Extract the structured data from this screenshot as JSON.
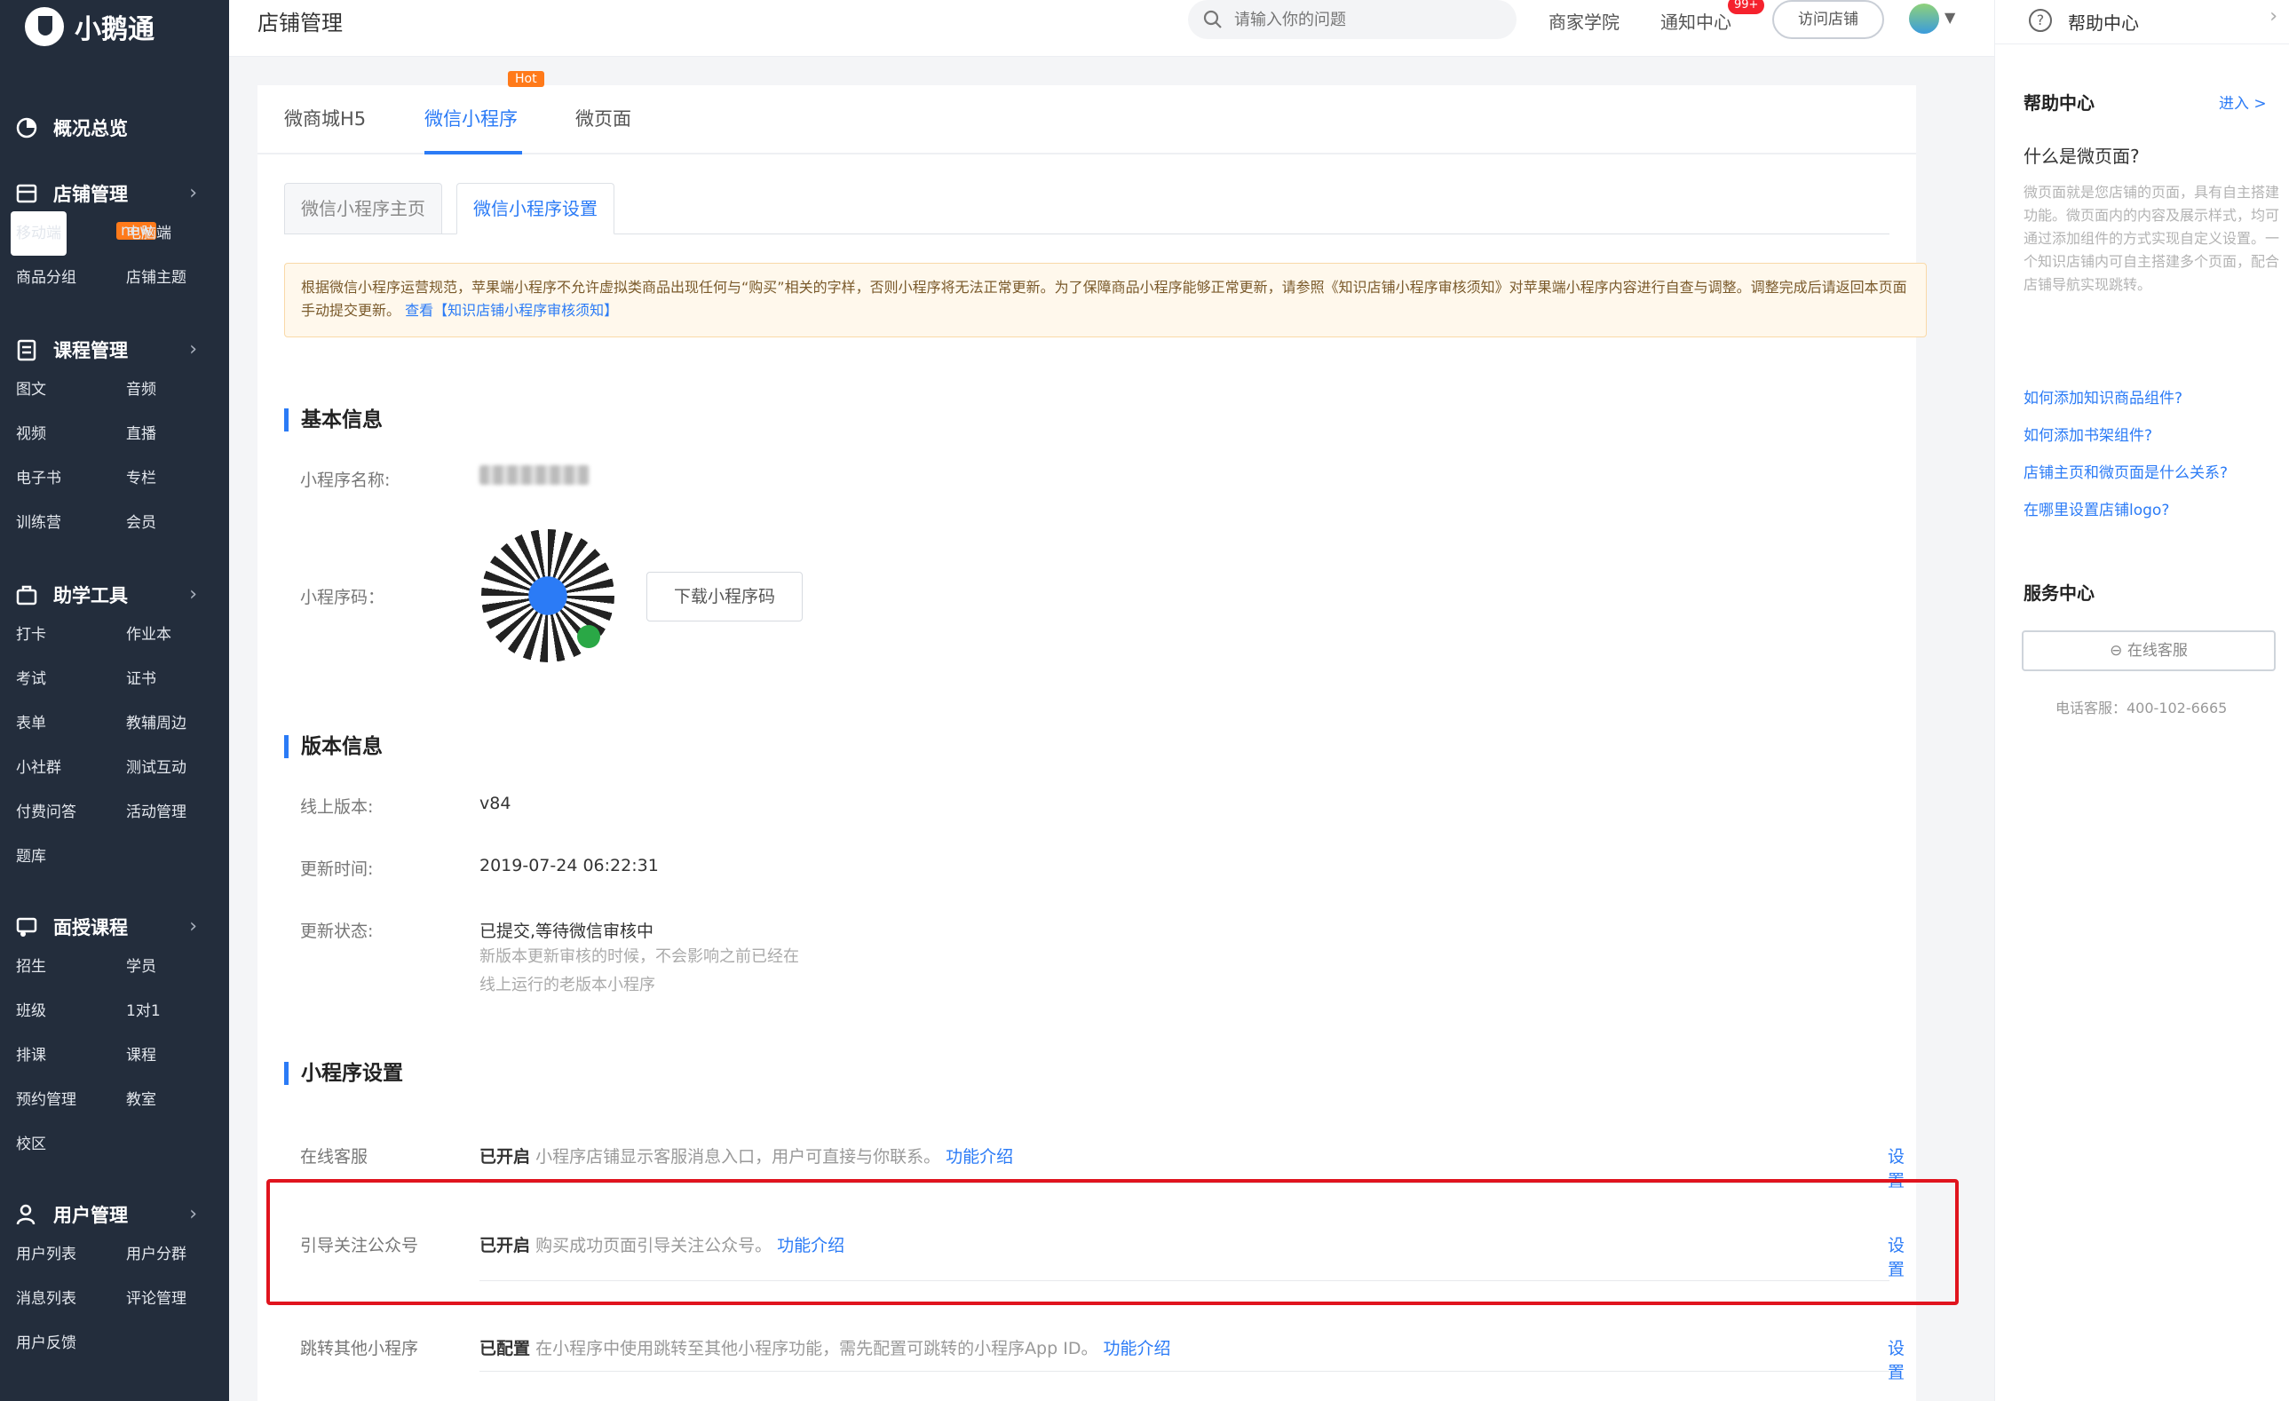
{
  "app": {
    "name": "小鹅通"
  },
  "sidebar": {
    "groups": [
      {
        "label": "概况总览",
        "items": []
      },
      {
        "label": "店铺管理",
        "items": [
          "移动端",
          "电脑端",
          "商品分组",
          "店铺主题"
        ],
        "new_tag": "new"
      },
      {
        "label": "课程管理",
        "items": [
          "图文",
          "音频",
          "视频",
          "直播",
          "电子书",
          "专栏",
          "训练营",
          "会员"
        ]
      },
      {
        "label": "助学工具",
        "items": [
          "打卡",
          "作业本",
          "考试",
          "证书",
          "表单",
          "教辅周边",
          "小社群",
          "测试互动",
          "付费问答",
          "活动管理",
          "题库"
        ]
      },
      {
        "label": "面授课程",
        "items": [
          "招生",
          "学员",
          "班级",
          "1对1",
          "排课",
          "课程",
          "预约管理",
          "教室",
          "校区"
        ]
      },
      {
        "label": "用户管理",
        "items": [
          "用户列表",
          "用户分群",
          "消息列表",
          "评论管理",
          "用户反馈"
        ]
      }
    ]
  },
  "topbar": {
    "title": "店铺管理",
    "search_placeholder": "请输入你的问题",
    "school": "商家学院",
    "notice": "通知中心",
    "notice_badge": "99+",
    "visit": "访问店铺"
  },
  "tabs": [
    "微商城H5",
    "微信小程序",
    "微页面"
  ],
  "hot_tag": "Hot",
  "subtabs": [
    "微信小程序主页",
    "微信小程序设置"
  ],
  "notice": {
    "text": "根据微信小程序运营规范，苹果端小程序不允许虚拟类商品出现任何与“购买”相关的字样，否则小程序将无法正常更新。为了保障商品小程序能够正常更新，请参照《知识店铺小程序审核须知》对苹果端小程序内容进行自查与调整。调整完成后请返回本页面手动提交更新。",
    "link": "查看【知识店铺小程序审核须知】"
  },
  "basic": {
    "title": "基本信息",
    "name_label": "小程序名称:",
    "code_label": "小程序码：",
    "download_btn": "下载小程序码"
  },
  "version": {
    "title": "版本信息",
    "online_label": "线上版本:",
    "online_value": "v84",
    "time_label": "更新时间:",
    "time_value": "2019-07-24 06:22:31",
    "status_label": "更新状态:",
    "status_value": "已提交,等待微信审核中",
    "status_note1": "新版本更新审核的时候，不会影响之前已经在",
    "status_note2": "线上运行的老版本小程序"
  },
  "settings": {
    "title": "小程序设置",
    "rows": [
      {
        "label": "在线客服",
        "state": "已开启",
        "desc": "小程序店铺显示客服消息入口，用户可直接与你联系。",
        "link": "功能介绍",
        "action": "设置"
      },
      {
        "label": "引导关注公众号",
        "state": "已开启",
        "desc": "购买成功页面引导关注公众号。",
        "link": "功能介绍",
        "action": "设置"
      },
      {
        "label": "跳转其他小程序",
        "state": "已配置",
        "desc": "在小程序中使用跳转至其他小程序功能，需先配置可跳转的小程序App ID。",
        "link": "功能介绍",
        "action": "设置"
      }
    ]
  },
  "help": {
    "top_title": "帮助中心",
    "section_title": "帮助中心",
    "enter": "进入 >",
    "question": "什么是微页面?",
    "answer": "微页面就是您店铺的页面，具有自主搭建功能。微页面内的内容及展示样式，均可通过添加组件的方式实现自定义设置。一个知识店铺内可自主搭建多个页面，配合店铺导航实现跳转。",
    "faqs": [
      "如何添加知识商品组件?",
      "如何添加书架组件?",
      "店铺主页和微页面是什么关系?",
      "在哪里设置店铺logo?"
    ],
    "service_title": "服务中心",
    "cs_button": "⊖ 在线客服",
    "phone": "电话客服：400-102-6665"
  },
  "colors": {
    "accent": "#2b7bf6",
    "sidebar_bg": "#232d3c",
    "highlight": "#e0141e",
    "hot": "#ff7a1a"
  }
}
